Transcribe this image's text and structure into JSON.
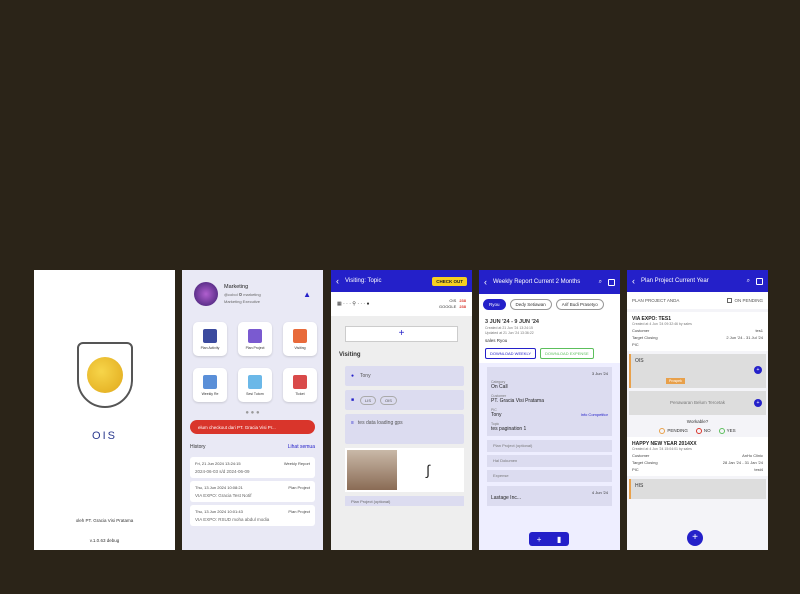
{
  "splash": {
    "brand": "OIS",
    "by": "oleh PT. Gracia Visi Pratama",
    "version": "v.1.0.63 debug"
  },
  "home": {
    "user_name": "Marketing",
    "user_line": "@cobol ✪ marketing",
    "user_role": "Marketing Executive",
    "tiles": [
      "Plan Activity",
      "Plan Project",
      "Visiting",
      "Weekly Re",
      "Sesi Tutorn",
      "Ticket"
    ],
    "banner": "elum checkout dari PT. Gracia Visi Pr...",
    "history_label": "History",
    "history_link": "Lihat semua",
    "history": [
      {
        "date": "Fri, 21 Jun 2024 13:24:15",
        "type": "Weekly Report",
        "desc": "2024-06-03 s/d 2024-06-09"
      },
      {
        "date": "Thu, 13 Jun 2024 10:08:21",
        "type": "Plan Project",
        "desc": "VIA EXPO: Gracia Test Notif"
      },
      {
        "date": "Thu, 13 Jun 2024 10:01:43",
        "type": "Plan Project",
        "desc": "VIA EXPO: RSUD moha abdul modia"
      }
    ]
  },
  "visiting": {
    "title": "Visiting: Topic",
    "checkout": "CHECK OUT",
    "ois_label": "OIS",
    "ois_val": "238",
    "google_label": "GOOGLE",
    "google_val": "238",
    "plus": "+",
    "section": "Visiting",
    "person": "Tony",
    "chip1": "LIS",
    "chip2": "OIS",
    "notes": "tes data loading gps",
    "optional": "Plan Project (optional)"
  },
  "weekly": {
    "title": "Weekly Report Current 2 Months",
    "tabs": [
      "Ryou",
      "Dedy Setiawan",
      "Arif Budi Prasetyo"
    ],
    "range": "3 JUN '24 - 9 JUN '24",
    "created": "Created at 21 Jun '24 13:24:15",
    "updated": "Updated at 21 Jun '24 13:36:22",
    "sales": "sales  Ryou",
    "btn_weekly": "DOWNLOAD WEEKLY",
    "btn_expense": "DOWNLOAD EXPENSE",
    "card_date": "3 Jun '24",
    "category_lbl": "Category",
    "category": "On Call",
    "customer_lbl": "Customer",
    "customer": "PT. Gracia Visi Pratama",
    "pic_lbl": "PIC",
    "pic": "Tony",
    "info": "Info Competitor",
    "topic_lbl": "Topic",
    "topic": "tes pagination 1",
    "sub1": "Plan Project (optional)",
    "sub2": "Hal Dokumen",
    "sub3": "Expense",
    "card2_date": "4 Jun '24",
    "card2_desc": "Lastage Inc..."
  },
  "plan": {
    "title": "Plan Project Current Year",
    "label": "PLAN PROJECT ANDA",
    "on_pending": "ON PENDING",
    "p1_name": "VIA EXPO: TES1",
    "p1_meta": "Created at 4 Jun '24 09:32:46 by sales",
    "customer_lbl": "Customer",
    "p1_customer": "tes1",
    "closing_lbl": "Target Closing",
    "p1_closing": "2 Jun '24 - 31 Jul '24",
    "pic_lbl": "PIC",
    "stage1": "OIS",
    "stage1_tag": "Prospek",
    "stage2": "Penawaran Belum Tercetak",
    "question": "Workable?",
    "opt_pending": "PENDING",
    "opt_no": "NO",
    "opt_yes": "YES",
    "p2_name": "HAPPY NEW YEAR 2014XX",
    "p2_meta": "Created at 4 Jun '24 15:04:01 by sales",
    "p2_customer": "AnHo Clinic",
    "p2_closing": "28 Jan '24 - 31 Jan '24",
    "p2_pic": "test4",
    "stage3": "HIS",
    "colors": {
      "primary": "#2420c9",
      "accent": "#f6cf21",
      "danger": "#d9352b"
    }
  }
}
